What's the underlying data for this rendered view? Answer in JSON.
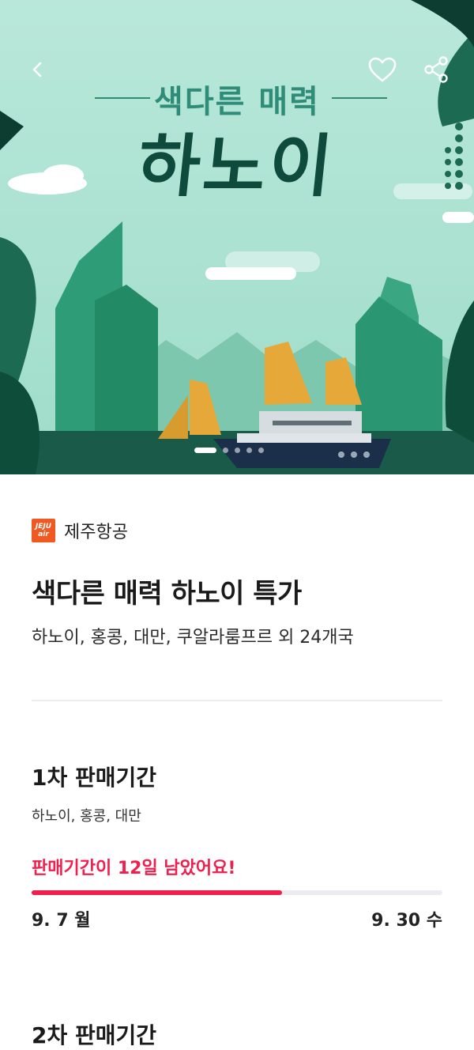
{
  "hero": {
    "banner_subtitle": "색다른 매력",
    "banner_title": "하노이",
    "slide_count": 5,
    "active_slide": 1
  },
  "icons": {
    "back": "chevron-left-icon",
    "favorite": "heart-icon",
    "share": "share-icon"
  },
  "airline": {
    "logo_text_top": "JEJU",
    "logo_text_bottom": "air",
    "name": "제주항공",
    "brand_color": "#f05a22"
  },
  "deal": {
    "title": "색다른 매력 하노이 특가",
    "destinations": "하노이, 홍콩, 대만, 쿠알라룸프르  외 24개국"
  },
  "period1": {
    "title": "1차 판매기간",
    "cities": "하노이, 홍콩, 대만",
    "remaining": "판매기간이 12일 남았어요!",
    "progress": 0.61,
    "start": "9. 7 월",
    "end": "9. 30 수"
  },
  "period2": {
    "title": "2차 판매기간"
  },
  "colors": {
    "accent": "#ef1f4e",
    "hero_bg": "#a8e0d0",
    "title_dark_green": "#0e4b3c"
  }
}
